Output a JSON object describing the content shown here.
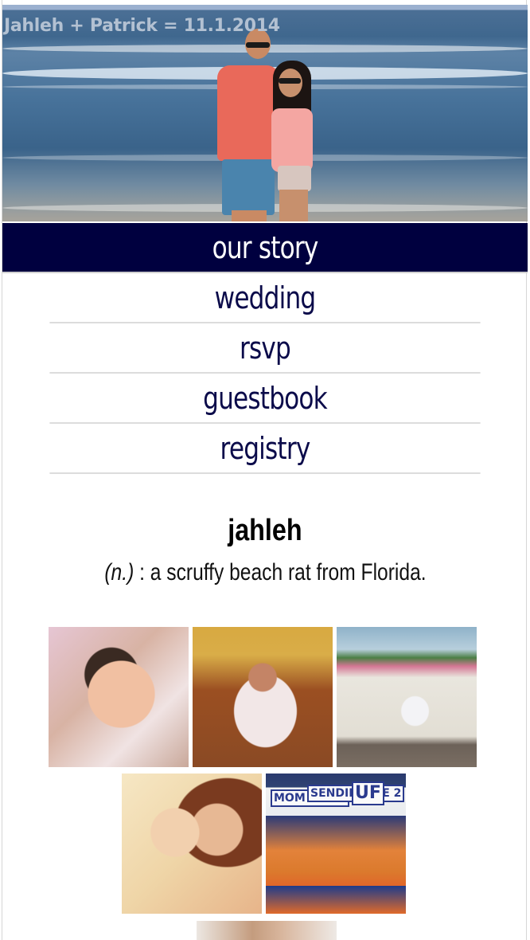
{
  "header": {
    "title": "Jahleh + Patrick = 11.1.2014"
  },
  "nav": {
    "items": [
      {
        "label": "our story",
        "active": true
      },
      {
        "label": "wedding",
        "active": false
      },
      {
        "label": "rsvp",
        "active": false
      },
      {
        "label": "guestbook",
        "active": false
      },
      {
        "label": "registry",
        "active": false
      }
    ]
  },
  "definition": {
    "word": "jahleh",
    "part_of_speech": "(n.)",
    "meaning": " : a scruffy beach rat from Florida."
  },
  "gallery": {
    "photo5_signs": [
      "MOM THX 4",
      "SENDING ME 2",
      "UF"
    ]
  },
  "colors": {
    "nav_active_bg": "#00003f",
    "nav_text": "#0b0b4a"
  }
}
